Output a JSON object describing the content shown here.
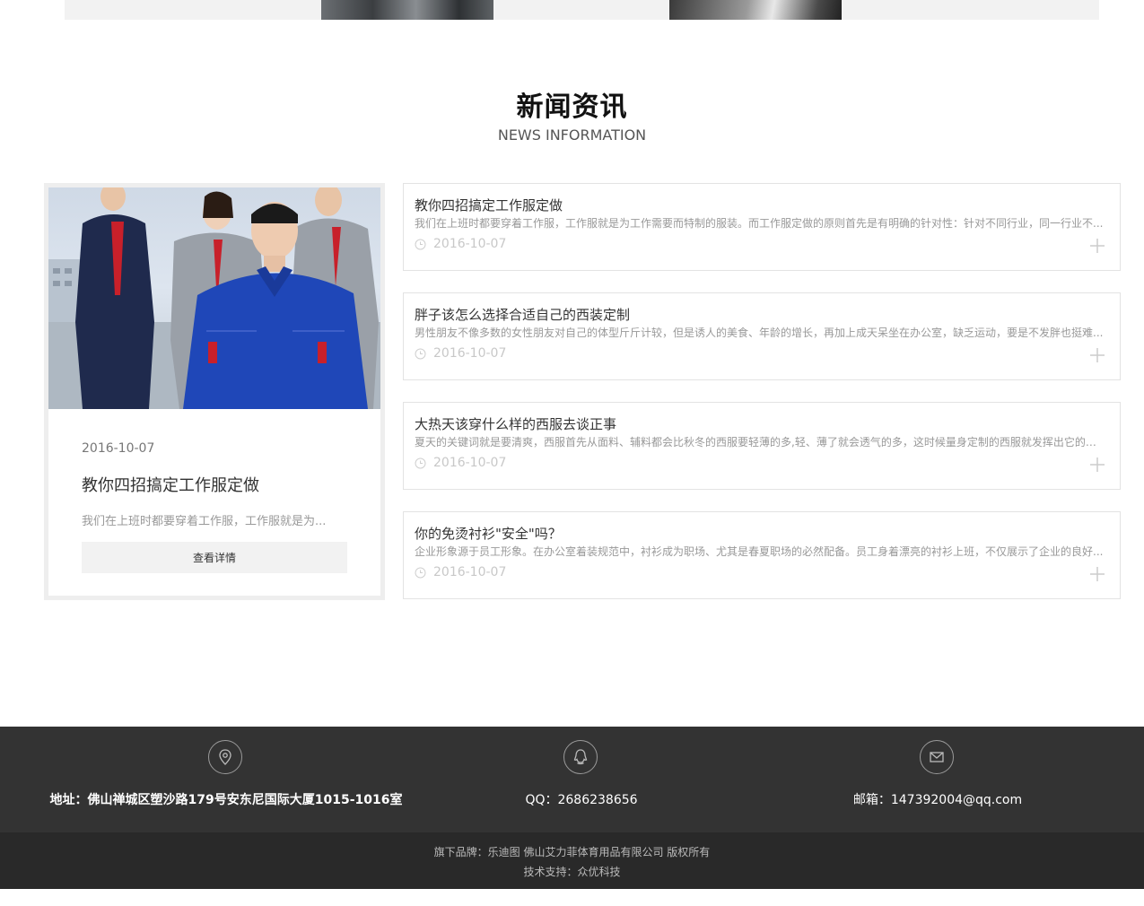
{
  "section": {
    "title": "新闻资讯",
    "subtitle": "NEWS INFORMATION"
  },
  "featured": {
    "date": "2016-10-07",
    "title": "教你四招搞定工作服定做",
    "summary": "我们在上班时都要穿着工作服，工作服就是为...",
    "button_label": "查看详情"
  },
  "news": [
    {
      "title": "教你四招搞定工作服定做",
      "summary": "我们在上班时都要穿着工作服，工作服就是为工作需要而特制的服装。而工作服定做的原则首先是有明确的针对性：针对不同行业，同一行业不...",
      "date": "2016-10-07"
    },
    {
      "title": "胖子该怎么选择合适自己的西装定制",
      "summary": "男性朋友不像多数的女性朋友对自己的体型斤斤计较，但是诱人的美食、年龄的增长，再加上成天呆坐在办公室，缺乏运动，要是不发胖也挺难...",
      "date": "2016-10-07"
    },
    {
      "title": "大热天该穿什么样的西服去谈正事",
      "summary": "夏天的关键词就是要清爽，西服首先从面料、辅料都会比秋冬的西服要轻薄的多,轻、薄了就会透气的多，这时候量身定制的西服就发挥出它的优...",
      "date": "2016-10-07"
    },
    {
      "title": "你的免烫衬衫\"安全\"吗？",
      "summary": "企业形象源于员工形象。在办公室着装规范中，衬衫成为职场、尤其是春夏职场的必然配备。员工身着漂亮的衬衫上班，不仅展示了企业的良好...",
      "date": "2016-10-07"
    }
  ],
  "footer": {
    "address": "地址：佛山禅城区塑沙路179号安东尼国际大厦1015-1016室",
    "qq": "QQ：2686238656",
    "email": "邮箱：147392004@qq.com",
    "icons": [
      "location-icon",
      "qq-icon",
      "mail-icon"
    ],
    "copyright": "旗下品牌：乐迪图 佛山艾力菲体育用品有限公司 版权所有",
    "support": "技术支持：众优科技"
  },
  "colors": {
    "footer_bg": "#333333",
    "footer_bottom_bg": "#292929",
    "card_border": "#eeeeee"
  }
}
